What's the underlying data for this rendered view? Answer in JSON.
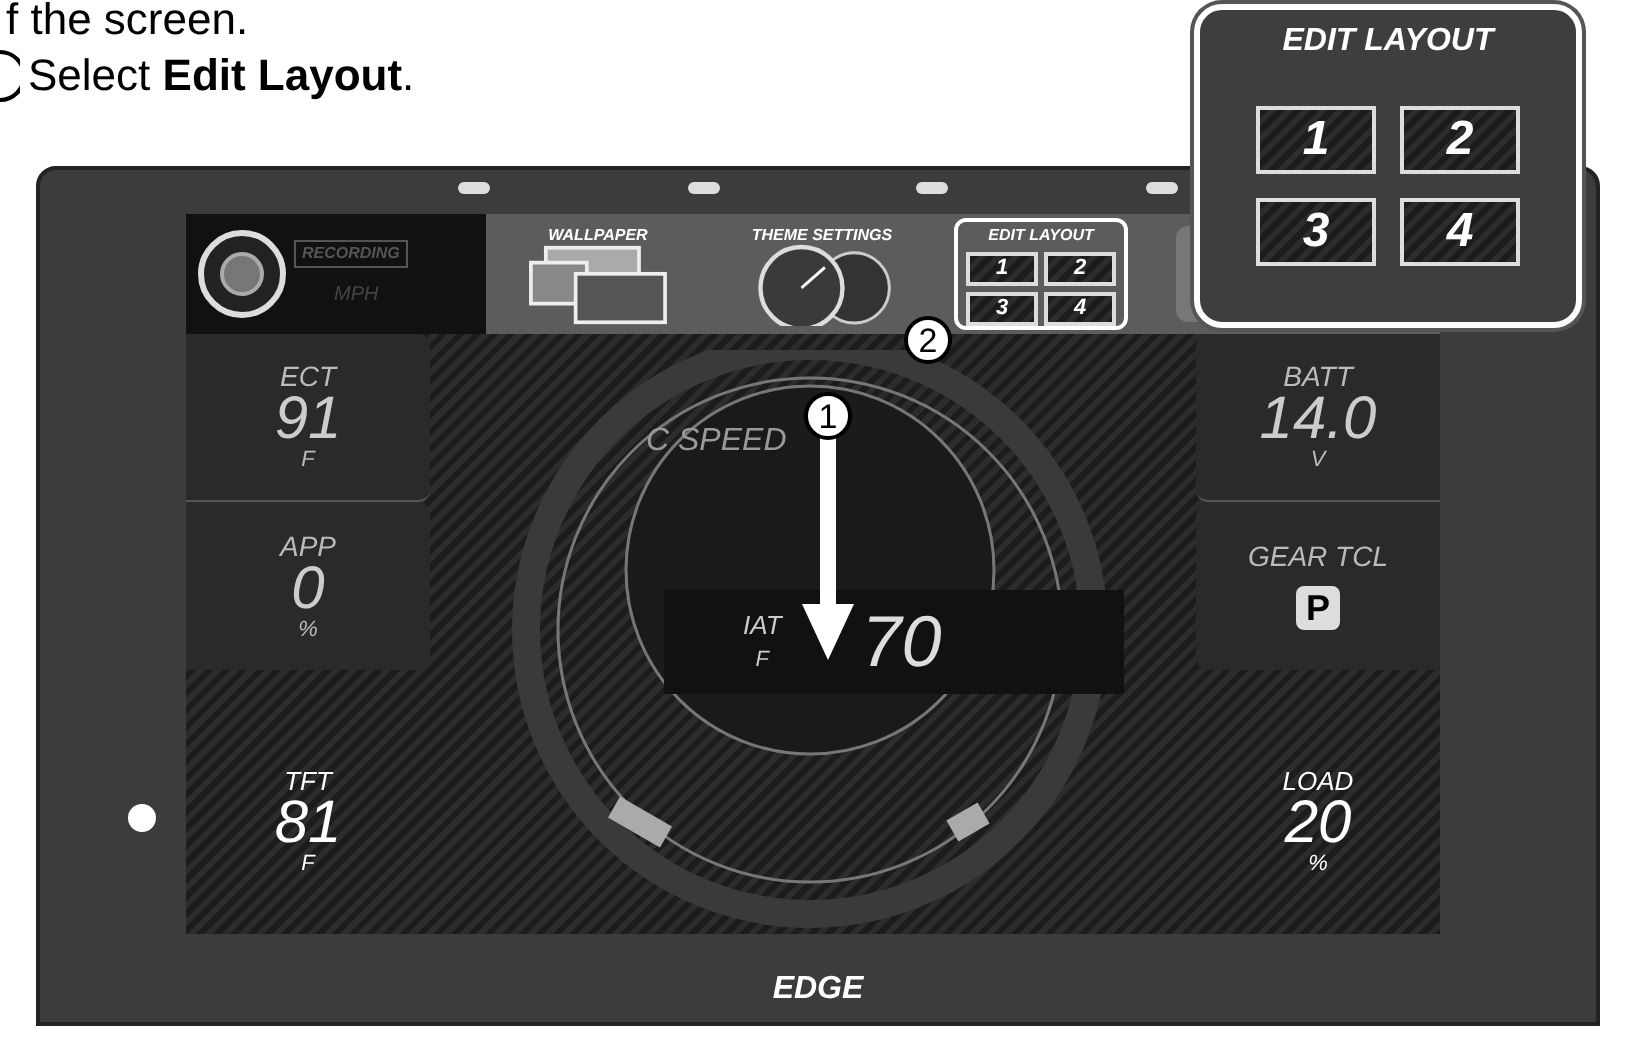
{
  "instruction": {
    "cut_line": "f the screen.",
    "step_text": "Select **Edit Layout**."
  },
  "menu": {
    "recording": "RECORDING",
    "speed_unit": "MPH",
    "items": [
      {
        "label": "WALLPAPER",
        "kind": "wallpaper",
        "selected": false
      },
      {
        "label": "THEME SETTINGS",
        "kind": "theme",
        "selected": false
      },
      {
        "label": "EDIT LAYOUT",
        "kind": "layout",
        "selected": true,
        "tiles": [
          "1",
          "2",
          "3",
          "4"
        ]
      }
    ]
  },
  "gauges_left": [
    {
      "label": "ECT",
      "value": "91",
      "unit": "F",
      "kind": "number"
    },
    {
      "label": "APP",
      "value": "0",
      "unit": "%",
      "kind": "number"
    }
  ],
  "gauges_right": [
    {
      "label": "BATT",
      "value": "14.0",
      "unit": "V",
      "kind": "number"
    },
    {
      "label": "GEAR TCL",
      "value": "P",
      "kind": "gear"
    }
  ],
  "bottom_left": {
    "label": "TFT",
    "value": "81",
    "unit": "F"
  },
  "bottom_right": {
    "label": "LOAD",
    "value": "20",
    "unit": "%"
  },
  "center": {
    "label": "C SPEED",
    "iat": {
      "label": "IAT",
      "unit": "F",
      "value": "70"
    }
  },
  "brand": "EDGE",
  "markers": [
    "1",
    "2"
  ],
  "callout": {
    "title": "EDIT LAYOUT",
    "tiles": [
      "1",
      "2",
      "3",
      "4"
    ]
  }
}
